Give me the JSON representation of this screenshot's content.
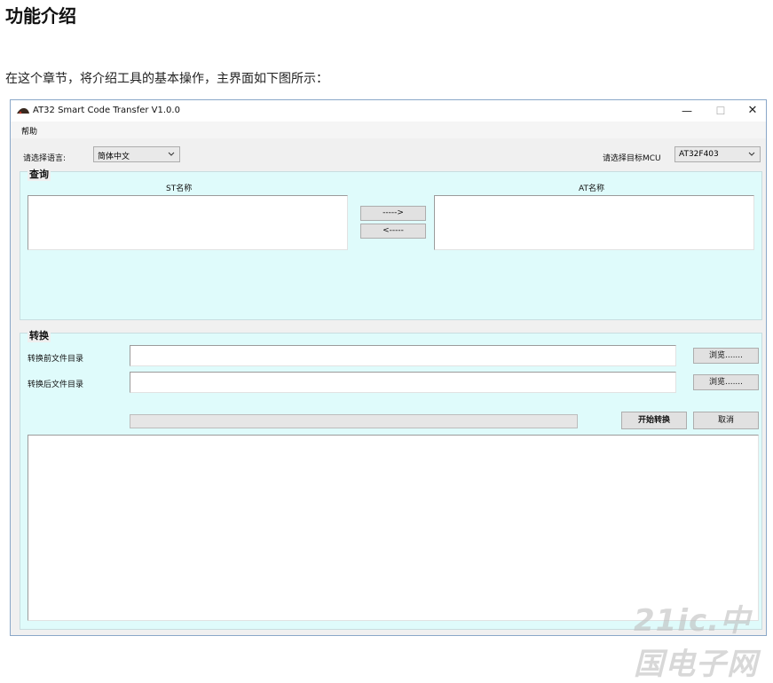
{
  "doc": {
    "heading": "功能介绍",
    "paragraph": "在这个章节，将介绍工具的基本操作，主界面如下图所示："
  },
  "window": {
    "title": "AT32 Smart Code Transfer V1.0.0",
    "minimize": "—",
    "maximize": "☐",
    "close": "✕",
    "menu": {
      "help": "帮助"
    }
  },
  "language": {
    "label": "请选择语言:",
    "selected": "简体中文"
  },
  "mcu": {
    "label": "请选择目标MCU",
    "selected": "AT32F403"
  },
  "query": {
    "title": "查询",
    "st_header": "ST名称",
    "at_header": "AT名称",
    "to_at_button": "----->",
    "to_st_button": "<-----"
  },
  "convert": {
    "title": "转换",
    "source_label": "转换前文件目录",
    "target_label": "转换后文件目录",
    "source_value": "",
    "target_value": "",
    "browse_source": "浏览.......",
    "browse_target": "浏览.......",
    "start_button": "开始转换",
    "cancel_button": "取消",
    "progress": 0
  },
  "watermark": "21ic.中国电子网",
  "colors": {
    "group_bg": "#dffbfb",
    "window_bg": "#f0f0f0"
  }
}
